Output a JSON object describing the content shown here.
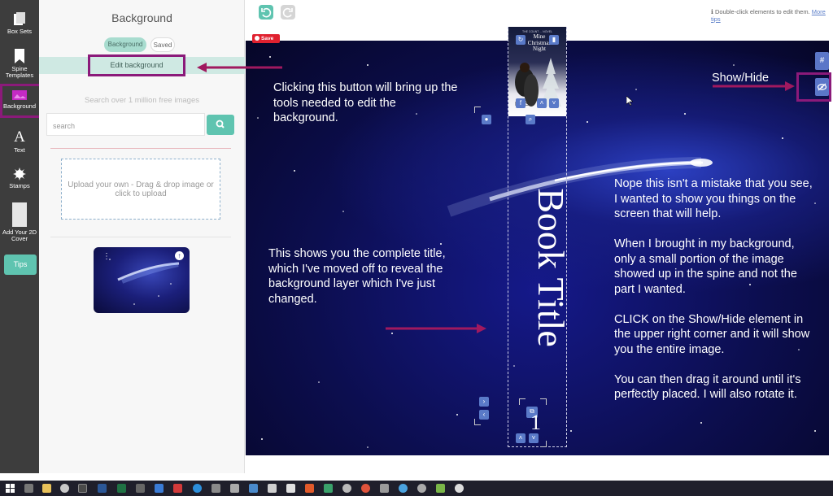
{
  "toolbar": {
    "items": [
      {
        "label": "Box Sets",
        "icon": "box-sets-icon"
      },
      {
        "label": "Spine Templates",
        "icon": "bookmark-icon"
      },
      {
        "label": "Background",
        "icon": "image-icon"
      },
      {
        "label": "Text",
        "icon": "text-icon"
      },
      {
        "label": "Stamps",
        "icon": "stamp-icon"
      },
      {
        "label": "Add Your 2D Cover",
        "icon": "cover-icon"
      }
    ],
    "tips_label": "Tips",
    "active_color": "#c42ac4",
    "accent": "#5fc4b0"
  },
  "panel": {
    "title": "Background",
    "tabs": [
      "Background",
      "Saved"
    ],
    "edit_button": "Edit background",
    "search_caption": "Search over 1 million free images",
    "search_placeholder": "search",
    "dropzone_text": "Upload your own - Drag & drop image or click to upload"
  },
  "topbar": {
    "hint": "Double-click elements to edit them.",
    "hint_link": "More tips"
  },
  "canvas": {
    "save_label": "Save",
    "book_title": "Book Title",
    "spine_number": "1",
    "cover_title_line1": "Mine",
    "cover_title_line2": "Christmas",
    "cover_title_line3": "Night",
    "cover_top_text": "THE COUNT ... NOVEL",
    "cover_bottom_text": "L.A.S.",
    "side_button_1": "#"
  },
  "annotations": {
    "show_hide": "Show/Hide",
    "edit_button_note": "Clicking this button will bring up the tools needed to edit the background.",
    "title_note": "This shows you the complete title, which I've moved off to reveal the background layer which I've just changed.",
    "right_note": [
      "Nope this isn't a mistake that you see, I wanted to show you things on the screen that will help.",
      "When I brought in my background, only a small portion of the image showed up in the spine and not the part I wanted.",
      "CLICK on the Show/Hide element in the upper right corner and it will show you the entire image.",
      "You can then drag it around until it's perfectly placed. I will also rotate it."
    ],
    "arrow_color": "#a0195f",
    "box_color": "#8b1a7a"
  }
}
